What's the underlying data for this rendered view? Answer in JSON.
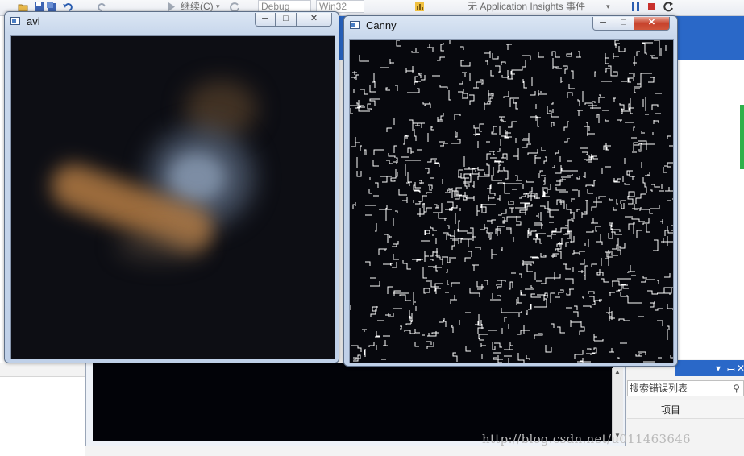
{
  "vs_toolbar": {
    "continue_label": "继续(C)",
    "continue_arrow": "▾",
    "configuration": "Debug",
    "platform": "Win32",
    "insights_label": "无 Application Insights 事件",
    "insights_arrow": "▾"
  },
  "vs_panel": {
    "search_placeholder": "搜索错误列表",
    "search_icon": "search-icon",
    "column_project": "项目",
    "pin_glyph": "▾",
    "pushpin_glyph": "ꟷ",
    "close_glyph": "✕"
  },
  "watermark": "http://blog.csdn.net/u011463646",
  "windows": {
    "avi": {
      "title": "avi",
      "min": "─",
      "max": "□",
      "close": "✕"
    },
    "canny": {
      "title": "Canny",
      "min": "─",
      "max": "□",
      "close": "✕"
    }
  },
  "colors": {
    "vs_accent": "#2a68c8",
    "close_red": "#c7432c",
    "edge_white": "#ffffff",
    "status_green": "#2fb14a"
  }
}
